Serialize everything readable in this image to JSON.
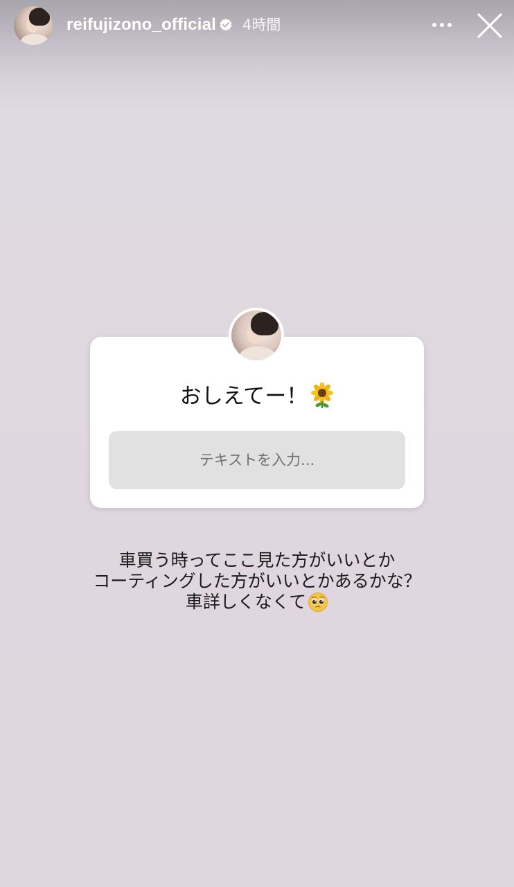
{
  "header": {
    "username": "reifujizono_official",
    "verified_icon": "verified-badge-icon",
    "time_ago": "4時間",
    "more_icon": "more-horizontal-icon",
    "close_icon": "close-icon"
  },
  "question_sticker": {
    "question": "おしえてー！",
    "question_emoji": "sunflower-icon",
    "input_placeholder": "テキストを入力..."
  },
  "caption": {
    "lines": [
      "車買う時ってここ見た方がいいとか",
      "コーティングした方がいいとかあるかな？",
      "車詳しくなくて"
    ],
    "trailing_emoji": "pleading-face-icon"
  },
  "colors": {
    "background": "#e0d6de",
    "card": "#ffffff",
    "input_bg": "#e1e1e1",
    "text": "#111111"
  }
}
